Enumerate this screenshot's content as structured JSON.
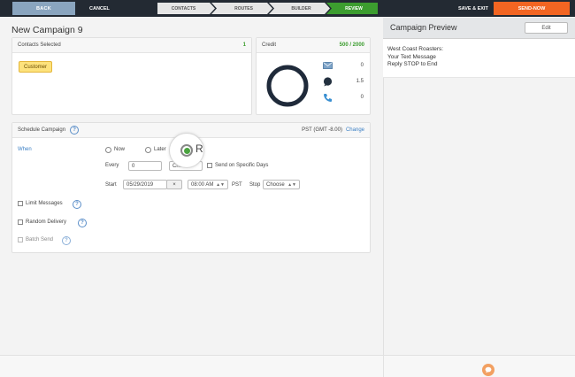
{
  "topbar": {
    "back_label": "BACK",
    "cancel_label": "CANCEL",
    "steps": [
      "CONTACTS",
      "ROUTES",
      "BUILDER",
      "REVIEW"
    ],
    "save_exit_label": "SAVE & EXIT",
    "send_now_label": "SEND-NOW",
    "accent_color": "#f26522",
    "active_step_color": "#3c9d2f"
  },
  "page": {
    "title": "New Campaign 9"
  },
  "contacts": {
    "header": "Contacts Selected",
    "count": "1",
    "tag": "Customer"
  },
  "credit": {
    "header": "Credit",
    "amount": "500 / 2000",
    "items": [
      {
        "icon": "email-icon",
        "value": "0"
      },
      {
        "icon": "chat-icon",
        "value": "1.5"
      },
      {
        "icon": "phone-icon",
        "value": "0"
      }
    ]
  },
  "schedule": {
    "header": "Schedule Campaign",
    "timezone": "PST (GMT -8.00)",
    "change_label": "Change",
    "when_label": "When",
    "options": {
      "now": "Now",
      "later": "Later",
      "repeat": "Rep"
    },
    "every_label": "Every",
    "every_value": "0",
    "choose_label": "Choose",
    "specific_days_label": "Send on Specific Days",
    "start_label": "Start",
    "start_date": "05/29/2019",
    "clear_glyph": "×",
    "start_time": "08:00 AM",
    "time_tz": "PST",
    "stop_label": "Stop",
    "stop_choose": "Choose",
    "limit_messages": "Limit Messages",
    "random_delivery": "Random Delivery",
    "batch_send": "Batch Send"
  },
  "preview": {
    "title": "Campaign Preview",
    "edit_label": "Edit",
    "lines": [
      "West Coast Roasters:",
      "Your Text Message",
      "Reply STOP to End"
    ]
  },
  "help_glyph": "?"
}
